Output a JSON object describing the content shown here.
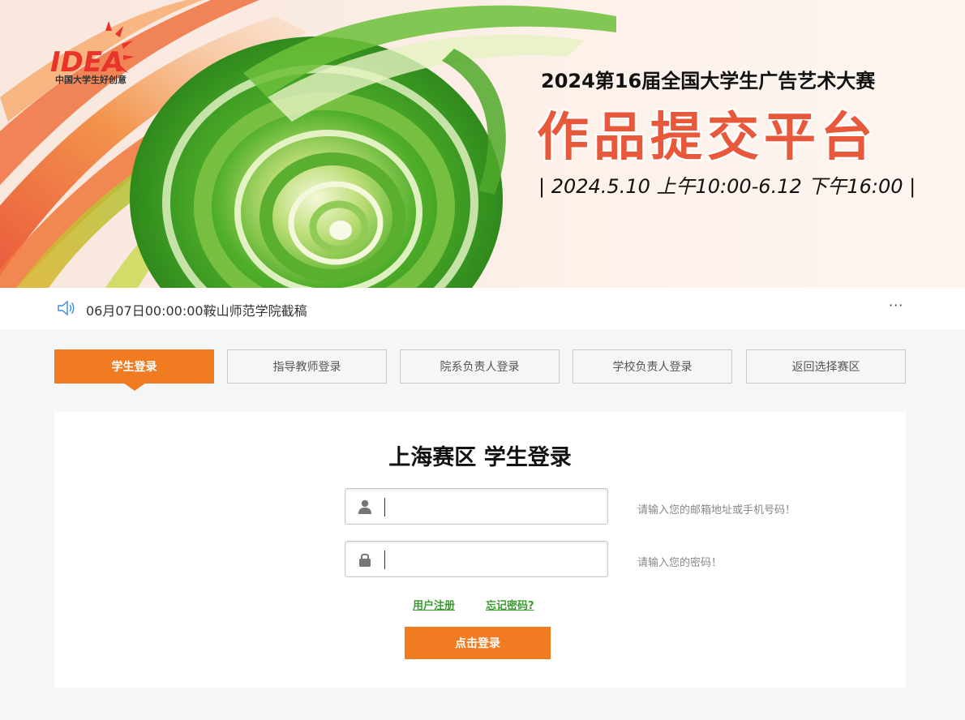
{
  "banner": {
    "logo_text": "中国大学生好创意",
    "logo_mark": "IDEA",
    "line1": "2024第16届全国大学生广告艺术大赛",
    "line2": "作品提交平台",
    "line3": "| 2024.5.10 上午10:00-6.12 下午16:00 |"
  },
  "notice": {
    "icon": "speaker-icon",
    "text": "06月07日00:00:00鞍山师范学院截稿",
    "more_label": "···"
  },
  "tabs": [
    {
      "label": "学生登录",
      "active": true
    },
    {
      "label": "指导教师登录",
      "active": false
    },
    {
      "label": "院系负责人登录",
      "active": false
    },
    {
      "label": "学校负责人登录",
      "active": false
    },
    {
      "label": "返回选择赛区",
      "active": false
    }
  ],
  "login": {
    "title": "上海赛区 学生登录",
    "account": {
      "value": "",
      "placeholder": "",
      "icon": "user-icon",
      "hint": "请输入您的邮箱地址或手机号码！"
    },
    "password": {
      "value": "",
      "placeholder": "",
      "icon": "lock-icon",
      "hint": "请输入您的密码！"
    },
    "register_link": "用户注册",
    "forgot_link": "忘记密码?",
    "submit_label": "点击登录"
  },
  "colors": {
    "accent": "#f07b20",
    "banner_title": "#e8583a",
    "link": "#3a9a2e"
  }
}
